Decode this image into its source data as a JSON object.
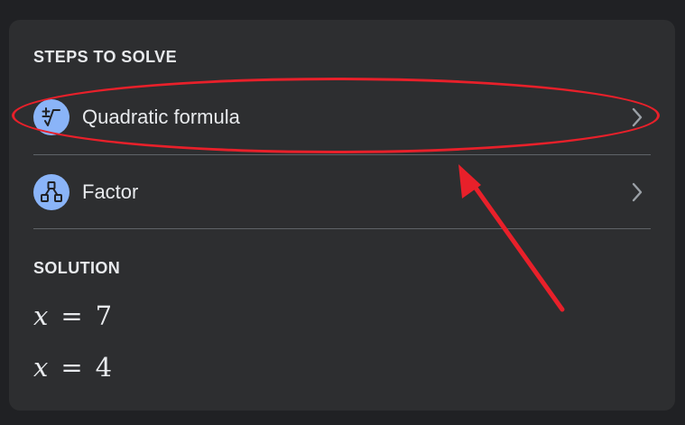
{
  "steps_section": {
    "title": "STEPS TO SOLVE",
    "items": [
      {
        "label": "Quadratic formula",
        "icon": "quadratic-formula-icon"
      },
      {
        "label": "Factor",
        "icon": "factor-tree-icon"
      }
    ]
  },
  "solution_section": {
    "title": "SOLUTION",
    "solutions": [
      {
        "variable": "x",
        "operator": "=",
        "value": "7"
      },
      {
        "variable": "x",
        "operator": "=",
        "value": "4"
      }
    ]
  },
  "colors": {
    "background": "#202124",
    "card": "#2d2e30",
    "icon_circle": "#8ab4f8",
    "text": "#e8eaed",
    "annotation": "#e8202a"
  }
}
